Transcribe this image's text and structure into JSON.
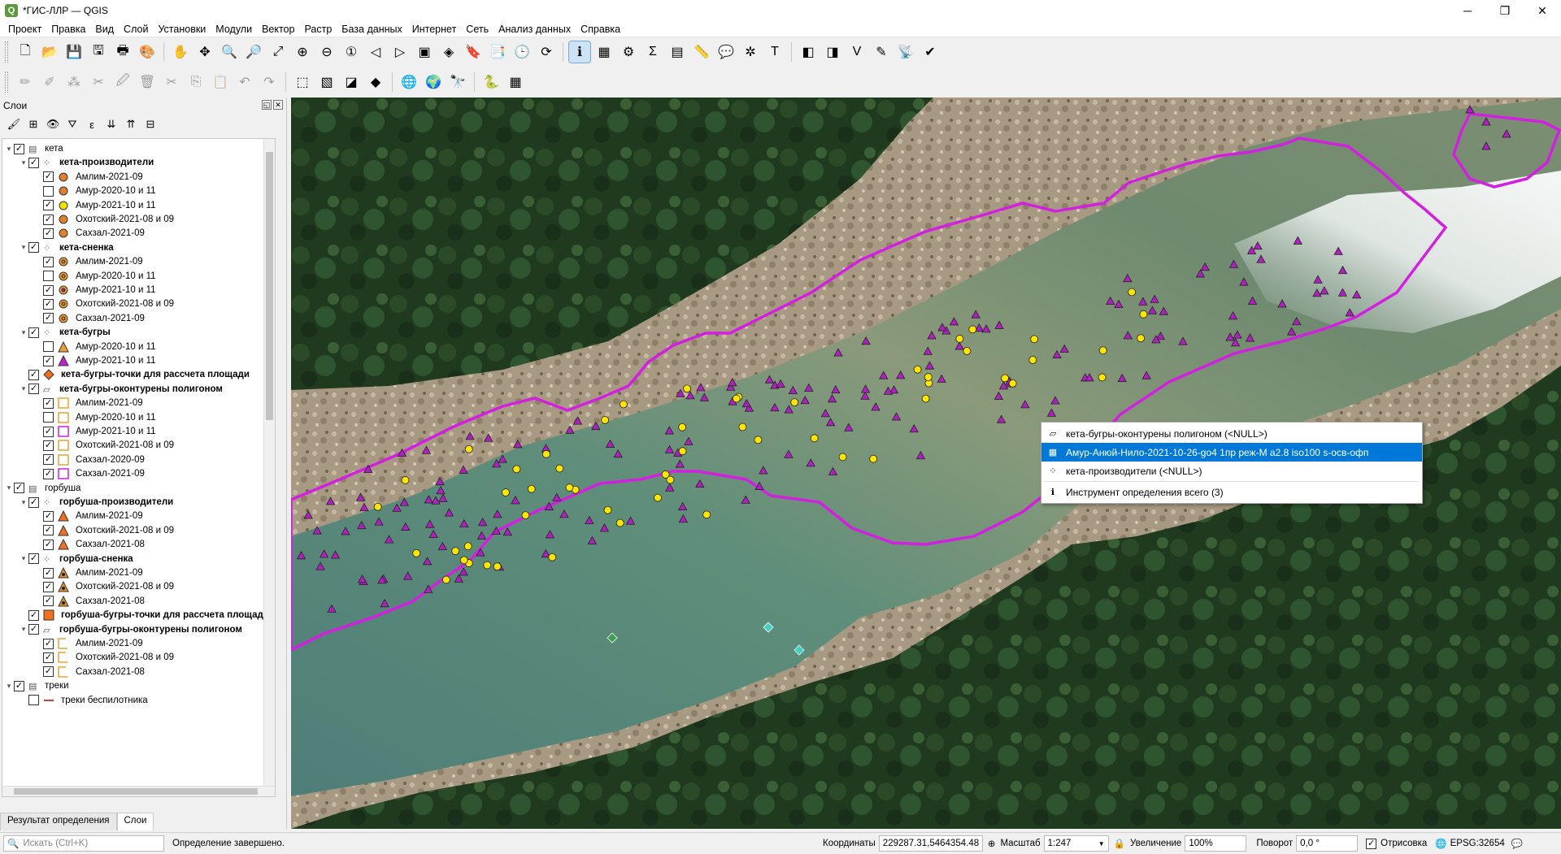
{
  "window": {
    "title": "*ГИС-ЛЛР — QGIS",
    "minimize": "─",
    "maximize": "❐",
    "close": "✕"
  },
  "menu": [
    "Проект",
    "Правка",
    "Вид",
    "Слой",
    "Установки",
    "Модули",
    "Вектор",
    "Растр",
    "База данных",
    "Интернет",
    "Сеть",
    "Анализ данных",
    "Справка"
  ],
  "toolbar1": [
    {
      "name": "new-project-icon",
      "glyph": "🗋"
    },
    {
      "name": "open-project-icon",
      "glyph": "📂"
    },
    {
      "name": "save-project-icon",
      "glyph": "💾"
    },
    {
      "name": "save-as-icon",
      "glyph": "🖫"
    },
    {
      "name": "print-layout-icon",
      "glyph": "🖶"
    },
    {
      "name": "style-manager-icon",
      "glyph": "🎨"
    },
    {
      "sep": true
    },
    {
      "name": "pan-icon",
      "glyph": "✋"
    },
    {
      "name": "pan-to-selection-icon",
      "glyph": "✥"
    },
    {
      "name": "zoom-in-icon",
      "glyph": "🔍"
    },
    {
      "name": "zoom-out-icon",
      "glyph": "🔎"
    },
    {
      "name": "zoom-full-icon",
      "glyph": "⤢"
    },
    {
      "name": "zoom-selection-icon",
      "glyph": "⊕"
    },
    {
      "name": "zoom-layer-icon",
      "glyph": "⊖"
    },
    {
      "name": "zoom-native-icon",
      "glyph": "①"
    },
    {
      "name": "zoom-last-icon",
      "glyph": "◁"
    },
    {
      "name": "zoom-next-icon",
      "glyph": "▷"
    },
    {
      "name": "new-map-view-icon",
      "glyph": "▣"
    },
    {
      "name": "new-3d-view-icon",
      "glyph": "◈"
    },
    {
      "name": "bookmark-new-icon",
      "glyph": "🔖"
    },
    {
      "name": "bookmarks-icon",
      "glyph": "📑"
    },
    {
      "name": "temporal-icon",
      "glyph": "🕒"
    },
    {
      "name": "refresh-icon",
      "glyph": "⟳"
    },
    {
      "sep": true
    },
    {
      "name": "identify-icon",
      "glyph": "ℹ",
      "active": true
    },
    {
      "name": "select-feature-icon",
      "glyph": "▦"
    },
    {
      "name": "settings-gear-icon",
      "glyph": "⚙"
    },
    {
      "name": "statistics-sigma-icon",
      "glyph": "Σ"
    },
    {
      "name": "attribute-table-icon",
      "glyph": "▤"
    },
    {
      "name": "measure-icon",
      "glyph": "📏"
    },
    {
      "name": "map-tips-icon",
      "glyph": "💬"
    },
    {
      "name": "spatial-bookmark-icon",
      "glyph": "✲"
    },
    {
      "name": "text-annotation-icon",
      "glyph": "T"
    },
    {
      "sep": true
    },
    {
      "name": "digitize-add-icon",
      "glyph": "◧"
    },
    {
      "name": "digitize-add-2-icon",
      "glyph": "◨"
    },
    {
      "name": "vertex-tool-icon",
      "glyph": "V"
    },
    {
      "name": "trace-icon",
      "glyph": "✎"
    },
    {
      "name": "gps-icon",
      "glyph": "📡"
    },
    {
      "name": "georef-icon",
      "glyph": "✔"
    }
  ],
  "toolbar2": [
    {
      "name": "edit-pencil-icon",
      "glyph": "✏"
    },
    {
      "name": "toggle-edit-icon",
      "glyph": "✐"
    },
    {
      "name": "add-point-icon",
      "glyph": "⁂"
    },
    {
      "name": "node-tool-icon",
      "glyph": "✂"
    },
    {
      "name": "save-edits-icon",
      "glyph": "🖉"
    },
    {
      "name": "delete-icon",
      "glyph": "🗑"
    },
    {
      "name": "cut-icon",
      "glyph": "✂"
    },
    {
      "name": "copy-icon",
      "glyph": "⎘"
    },
    {
      "name": "paste-icon",
      "glyph": "📋"
    },
    {
      "name": "undo-icon",
      "glyph": "↶"
    },
    {
      "name": "redo-icon",
      "glyph": "↷"
    },
    {
      "sep": true
    },
    {
      "name": "select-rect-icon",
      "glyph": "⬚"
    },
    {
      "name": "deselect-icon",
      "glyph": "▧"
    },
    {
      "name": "select-invert-icon",
      "glyph": "◪"
    },
    {
      "name": "label-icon",
      "glyph": "◆"
    },
    {
      "sep": true
    },
    {
      "name": "wms-icon",
      "glyph": "🌐"
    },
    {
      "name": "wfs-icon",
      "glyph": "🌍"
    },
    {
      "name": "globe-search-icon",
      "glyph": "🔭"
    },
    {
      "sep": true
    },
    {
      "name": "python-icon",
      "glyph": "🐍"
    },
    {
      "name": "grid-plugin-icon",
      "glyph": "▦"
    }
  ],
  "panel": {
    "title": "Слои",
    "tab_result": "Результат определения",
    "tab_layers": "Слои"
  },
  "layers": [
    {
      "level": 0,
      "expand": "▾",
      "checked": true,
      "icon": "group",
      "label": "кета",
      "bold": false
    },
    {
      "level": 1,
      "expand": "▾",
      "checked": true,
      "icon": "pointlayer",
      "label": "кета-производители",
      "bold": true
    },
    {
      "level": 2,
      "checked": true,
      "sym": "circle",
      "color": "#e07f2c",
      "label": "Амлим-2021-09"
    },
    {
      "level": 2,
      "checked": false,
      "sym": "circle",
      "color": "#e07f2c",
      "label": "Амур-2020-10 и 11"
    },
    {
      "level": 2,
      "checked": true,
      "sym": "circle",
      "color": "#f0e000",
      "label": "Амур-2021-10 и 11"
    },
    {
      "level": 2,
      "checked": true,
      "sym": "circle",
      "color": "#e07f2c",
      "label": "Охотский-2021-08 и 09"
    },
    {
      "level": 2,
      "checked": true,
      "sym": "circle",
      "color": "#e07f2c",
      "label": "Сахзал-2021-09"
    },
    {
      "level": 1,
      "expand": "▾",
      "checked": true,
      "icon": "pointlayer",
      "label": "кета-сненка",
      "bold": true
    },
    {
      "level": 2,
      "checked": true,
      "sym": "ring",
      "color": "#e07f2c",
      "label": "Амлим-2021-09"
    },
    {
      "level": 2,
      "checked": false,
      "sym": "ring",
      "color": "#e07f2c",
      "label": "Амур-2020-10 и 11"
    },
    {
      "level": 2,
      "checked": true,
      "sym": "ring",
      "color": "#b020c0",
      "label": "Амур-2021-10 и 11"
    },
    {
      "level": 2,
      "checked": true,
      "sym": "ring",
      "color": "#e07f2c",
      "label": "Охотский-2021-08 и 09"
    },
    {
      "level": 2,
      "checked": true,
      "sym": "ring",
      "color": "#e07f2c",
      "label": "Сахзал-2021-09"
    },
    {
      "level": 1,
      "expand": "▾",
      "checked": true,
      "icon": "pointlayer",
      "label": "кета-бугры",
      "bold": true
    },
    {
      "level": 2,
      "checked": false,
      "sym": "triangle",
      "color": "#f0a030",
      "label": "Амур-2020-10 и 11"
    },
    {
      "level": 2,
      "checked": true,
      "sym": "triangle",
      "color": "#c020d0",
      "label": "Амур-2021-10 и 11"
    },
    {
      "level": 1,
      "checked": true,
      "sym": "diamond",
      "color": "#f07020",
      "label": "кета-бугры-точки для рассчета площади",
      "bold": true
    },
    {
      "level": 1,
      "expand": "▾",
      "checked": true,
      "icon": "polylayer",
      "label": "кета-бугры-оконтурены полигоном",
      "bold": true
    },
    {
      "level": 2,
      "checked": true,
      "sym": "square",
      "color": "#f0a030",
      "label": "Амлим-2021-09"
    },
    {
      "level": 2,
      "checked": false,
      "sym": "square",
      "color": "#f0a030",
      "label": "Амур-2020-10 и 11"
    },
    {
      "level": 2,
      "checked": true,
      "sym": "square",
      "color": "#d020e0",
      "label": "Амур-2021-10 и 11"
    },
    {
      "level": 2,
      "checked": true,
      "sym": "square",
      "color": "#f0a030",
      "label": "Охотский-2021-08 и 09"
    },
    {
      "level": 2,
      "checked": true,
      "sym": "square",
      "color": "#f0a030",
      "label": "Сахзал-2020-09"
    },
    {
      "level": 2,
      "checked": true,
      "sym": "square",
      "color": "#d020e0",
      "label": "Сахзал-2021-09"
    },
    {
      "level": 0,
      "expand": "▾",
      "checked": true,
      "icon": "group",
      "label": "горбуша",
      "bold": false
    },
    {
      "level": 1,
      "expand": "▾",
      "checked": true,
      "icon": "pointlayer",
      "label": "горбуша-производители",
      "bold": true
    },
    {
      "level": 2,
      "checked": true,
      "sym": "triangle",
      "color": "#f07020",
      "label": "Амлим-2021-09"
    },
    {
      "level": 2,
      "checked": true,
      "sym": "triangle",
      "color": "#f07020",
      "label": "Охотский-2021-08 и 09"
    },
    {
      "level": 2,
      "checked": true,
      "sym": "triangle",
      "color": "#f07020",
      "label": "Сахзал-2021-08"
    },
    {
      "level": 1,
      "expand": "▾",
      "checked": true,
      "icon": "pointlayer",
      "label": "горбуша-сненка",
      "bold": true
    },
    {
      "level": 2,
      "checked": true,
      "sym": "tri-dot",
      "color": "#e09030",
      "label": "Амлим-2021-09"
    },
    {
      "level": 2,
      "checked": true,
      "sym": "tri-dot",
      "color": "#e09030",
      "label": "Охотский-2021-08 и 09"
    },
    {
      "level": 2,
      "checked": true,
      "sym": "tri-dot",
      "color": "#e09030",
      "label": "Сахзал-2021-08"
    },
    {
      "level": 1,
      "checked": true,
      "sym": "bigsquare",
      "color": "#f07020",
      "label": "горбуша-бугры-точки для рассчета площади",
      "bold": true
    },
    {
      "level": 1,
      "expand": "▾",
      "checked": true,
      "icon": "polylayer",
      "label": "горбуша-бугры-оконтурены полигоном",
      "bold": true
    },
    {
      "level": 2,
      "checked": true,
      "sym": "halfsquare",
      "color": "#f0a030",
      "label": "Амлим-2021-09"
    },
    {
      "level": 2,
      "checked": true,
      "sym": "halfsquare",
      "color": "#f0a030",
      "label": "Охотский-2021-08 и 09"
    },
    {
      "level": 2,
      "checked": true,
      "sym": "halfsquare",
      "color": "#f0a030",
      "label": "Сахзал-2021-08"
    },
    {
      "level": 0,
      "expand": "▾",
      "checked": true,
      "icon": "group",
      "label": "треки",
      "bold": false
    },
    {
      "level": 1,
      "checked": false,
      "sym": "line",
      "color": "#d04040",
      "label": "треки беспилотника",
      "bold": false
    }
  ],
  "context_menu": [
    {
      "icon": "polygon-layer-icon",
      "glyph": "▱",
      "label": "кета-бугры-оконтурены полигоном (<NULL>)",
      "selected": false
    },
    {
      "icon": "raster-layer-icon",
      "glyph": "▦",
      "label": "Амур-Анюй-Нило-2021-10-26-go4 1пр реж-M a2.8 iso100 s-осв-офп",
      "selected": true
    },
    {
      "icon": "point-layer-icon",
      "glyph": "⁘",
      "label": "кета-производители (<NULL>)",
      "selected": false
    },
    {
      "sep": true
    },
    {
      "icon": "identify-icon",
      "glyph": "ℹ",
      "label": "Инструмент определения всего (3)",
      "selected": false
    }
  ],
  "statusbar": {
    "search_placeholder": "Искать (Ctrl+K)",
    "message": "Определение завершено.",
    "coord_label": "Координаты",
    "coord_value": "229287.31,5464354.48",
    "scale_label": "Масштаб",
    "scale_value": "1:247",
    "magnifier_label": "Увеличение",
    "magnifier_value": "100%",
    "rotation_label": "Поворот",
    "rotation_value": "0,0 °",
    "render_label": "Отрисовка",
    "crs": "EPSG:32654"
  },
  "colors": {
    "accent": "#0078d7",
    "hull": "#d21fe0",
    "triangle": "#b020c0",
    "circle": "#ffe600",
    "diamond": "#40d0c0"
  }
}
